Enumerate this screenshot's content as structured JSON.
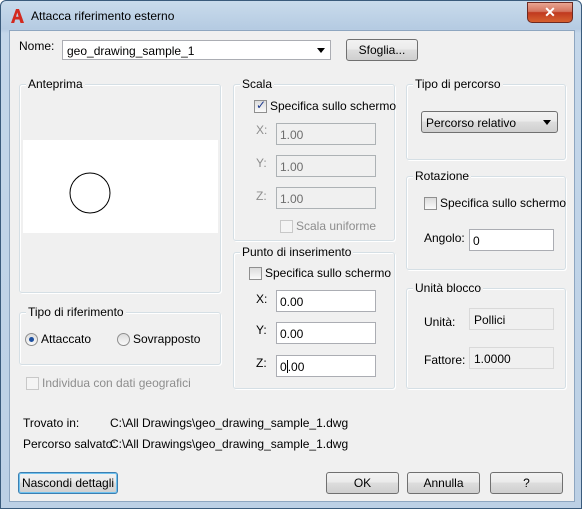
{
  "window": {
    "title": "Attacca riferimento esterno",
    "close_symbol": "✕"
  },
  "name_row": {
    "label": "Nome:",
    "value": "geo_drawing_sample_1",
    "browse_label": "Sfoglia..."
  },
  "preview": {
    "title": "Anteprima"
  },
  "reference_type": {
    "title": "Tipo di riferimento",
    "attach_label": "Attaccato",
    "overlay_label": "Sovrapposto",
    "selected": "Attaccato"
  },
  "geo_checkbox": {
    "label": "Individua con dati geografici",
    "checked": false,
    "enabled": false
  },
  "scale": {
    "title": "Scala",
    "specify_label": "Specifica sullo schermo",
    "specify_checked": true,
    "x_label": "X:",
    "x_value": "1.00",
    "y_label": "Y:",
    "y_value": "1.00",
    "z_label": "Z:",
    "z_value": "1.00",
    "uniform_label": "Scala uniforme",
    "uniform_checked": false
  },
  "insertion": {
    "title": "Punto di inserimento",
    "specify_label": "Specifica sullo schermo",
    "specify_checked": false,
    "x_label": "X:",
    "x_value": "0.00",
    "y_label": "Y:",
    "y_value": "0.00",
    "z_label": "Z:",
    "z_value_a": "0",
    "z_value_b": ".00"
  },
  "path_type": {
    "title": "Tipo di percorso",
    "value": "Percorso relativo"
  },
  "rotation": {
    "title": "Rotazione",
    "specify_label": "Specifica sullo schermo",
    "specify_checked": false,
    "angle_label": "Angolo:",
    "angle_value": "0"
  },
  "block_unit": {
    "title": "Unità blocco",
    "unit_label": "Unità:",
    "unit_value": "Pollici",
    "factor_label": "Fattore:",
    "factor_value": "1.0000"
  },
  "paths": {
    "found_label": "Trovato in:",
    "found_value": "C:\\All Drawings\\geo_drawing_sample_1.dwg",
    "saved_label": "Percorso salvato:",
    "saved_value": "C:\\All Drawings\\geo_drawing_sample_1.dwg"
  },
  "buttons": {
    "hide_details": "Nascondi dettagli",
    "ok": "OK",
    "cancel": "Annulla",
    "help": "?"
  },
  "colors": {
    "title_gradient_top": "#c9dbec",
    "close_red": "#c0391f",
    "app_icon_red": "#d32a1f"
  }
}
